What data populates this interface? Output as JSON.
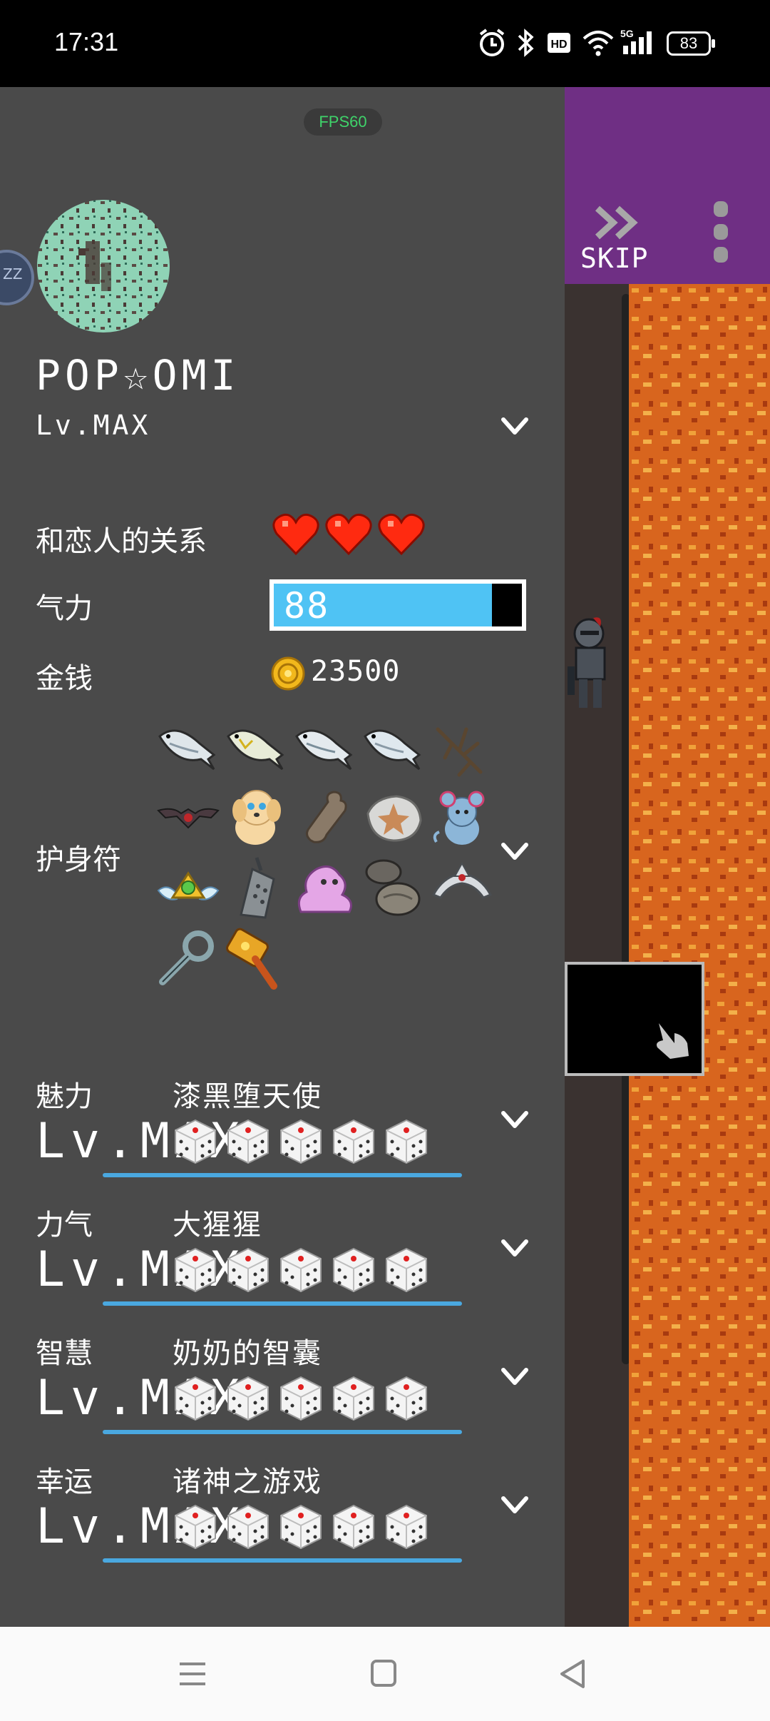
{
  "status_bar": {
    "time": "17:31",
    "icons": [
      "alarm-icon",
      "bluetooth-icon",
      "hd-icon",
      "wifi-icon",
      "signal-5g-icon"
    ],
    "battery_level": "83"
  },
  "fps": "FPS60",
  "zz_label": "ZZ",
  "character": {
    "name": "POP☆OMI",
    "level": "Lv.MAX"
  },
  "relationship": {
    "label": "和恋人的关系",
    "hearts": 3
  },
  "stamina": {
    "label": "气力",
    "value": "88",
    "fraction": 0.88
  },
  "money": {
    "label": "金钱",
    "value": "23500"
  },
  "charms": {
    "label": "护身符",
    "items": [
      "fish-icon",
      "fish-icon",
      "fish-icon",
      "fish-icon",
      "branch-icon",
      "bat-icon",
      "puppy-icon",
      "bone-icon",
      "starfish-fossil-icon",
      "blue-mouse-icon",
      "winged-gem-crown-icon",
      "grater-icon",
      "pink-slime-icon",
      "stones-icon",
      "tiara-icon",
      "magnifier-icon",
      "golden-hammer-icon"
    ]
  },
  "stats": [
    {
      "name": "魅力",
      "title": "漆黑堕天使",
      "level": "Lv.MAX",
      "dice": 5
    },
    {
      "name": "力气",
      "title": "大猩猩",
      "level": "Lv.MAX",
      "dice": 5
    },
    {
      "name": "智慧",
      "title": "奶奶的智囊",
      "level": "Lv.MAX",
      "dice": 5
    },
    {
      "name": "幸运",
      "title": "诸神之游戏",
      "level": "Lv.MAX",
      "dice": 5
    }
  ],
  "game": {
    "skip_label": "SKIP"
  },
  "colors": {
    "panel_bg": "#4a4a4a",
    "stamina_fill": "#4fc3f4",
    "stat_bar": "#4aa8e0",
    "purple_bar": "#6f2f84",
    "fps_green": "#3fd36a"
  },
  "nav": [
    "menu-icon",
    "home-square-icon",
    "back-triangle-icon"
  ]
}
